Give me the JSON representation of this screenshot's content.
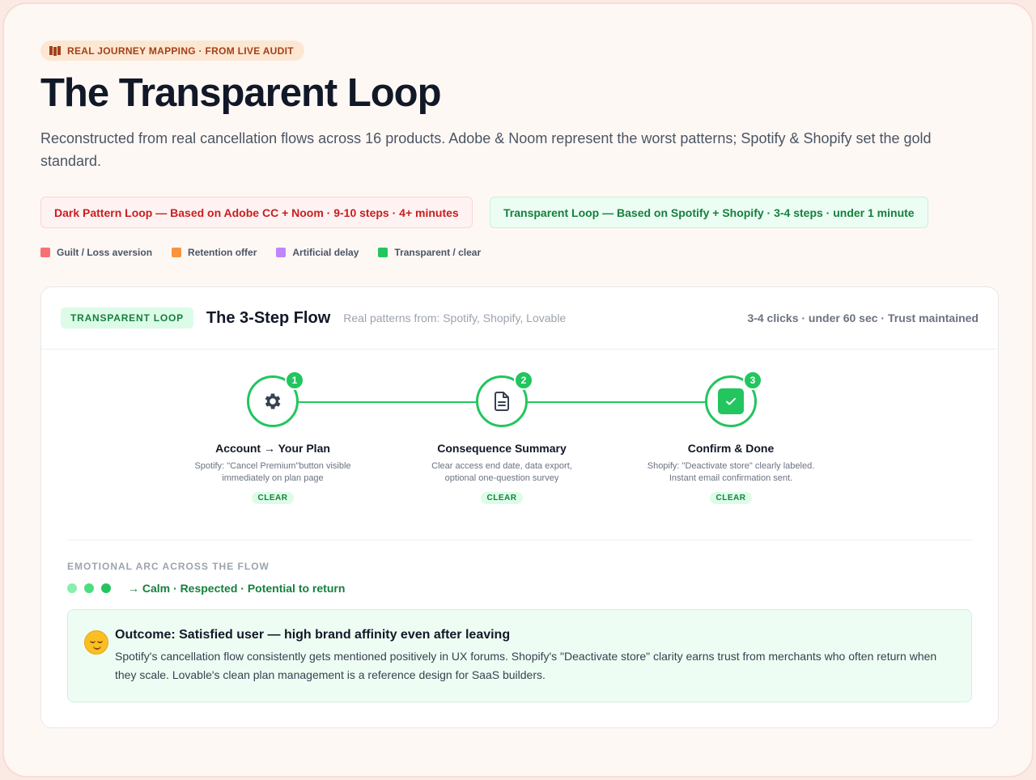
{
  "eyebrow": {
    "label": "REAL JOURNEY MAPPING · FROM LIVE AUDIT",
    "icon": "map-icon"
  },
  "title": "The Transparent Loop",
  "subtitle": "Reconstructed from real cancellation flows across 16 products. Adobe & Noom represent the worst patterns; Spotify & Shopify set the gold standard.",
  "pills": {
    "dark": "Dark Pattern Loop — Based on Adobe CC + Noom · 9-10 steps · 4+ minutes",
    "clear": "Transparent Loop — Based on Spotify + Shopify · 3-4 steps · under 1 minute"
  },
  "legend": [
    {
      "label": "Guilt / Loss aversion",
      "color": "#f87171"
    },
    {
      "label": "Retention offer",
      "color": "#fb923c"
    },
    {
      "label": "Artificial delay",
      "color": "#c084fc"
    },
    {
      "label": "Transparent / clear",
      "color": "#22c55e"
    }
  ],
  "card": {
    "tag": "TRANSPARENT LOOP",
    "title": "The 3-Step Flow",
    "sources": "Real patterns from: Spotify, Shopify, Lovable",
    "meta": "3-4 clicks · under 60 sec · Trust maintained",
    "steps": [
      {
        "number": "1",
        "icon": "gear-icon",
        "title": "Account → Your Plan",
        "desc": "Spotify: \"Cancel Premium\"button visible immediately on plan page",
        "chip": "CLEAR"
      },
      {
        "number": "2",
        "icon": "document-icon",
        "title": "Consequence Summary",
        "desc": "Clear access end date, data export, optional one-question survey",
        "chip": "CLEAR"
      },
      {
        "number": "3",
        "icon": "check-icon",
        "title": "Confirm & Done",
        "desc": "Shopify: \"Deactivate store\" clearly labeled. Instant email confirmation sent.",
        "chip": "CLEAR"
      }
    ],
    "arc": {
      "label": "EMOTIONAL ARC ACROSS THE FLOW",
      "dots": [
        "#86efac",
        "#4ade80",
        "#22c55e"
      ],
      "text": "→ Calm · Respected · Potential to return"
    },
    "outcome": {
      "icon": "relieved-face-icon",
      "title": "Outcome: Satisfied user — high brand affinity even after leaving",
      "body": "Spotify's cancellation flow consistently gets mentioned positively in UX forums. Shopify's \"Deactivate store\" clarity earns trust from merchants who often return when they scale. Lovable's clean plan management is a reference design for SaaS builders."
    }
  }
}
